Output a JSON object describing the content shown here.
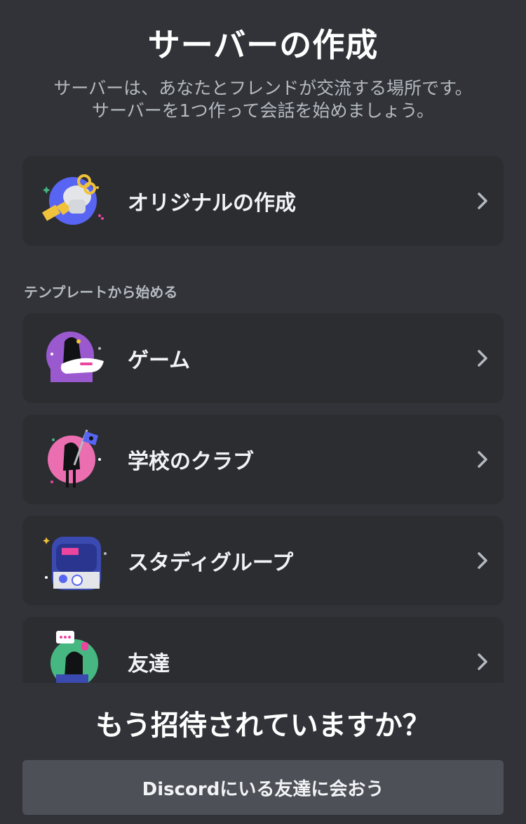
{
  "header": {
    "title": "サーバーの作成",
    "subtitle_line1": "サーバーは、あなたとフレンドが交流する場所です。",
    "subtitle_line2": "サーバーを1つ作って会話を始めましょう。"
  },
  "create_own": {
    "label": "オリジナルの作成",
    "icon": "chevron-right-icon"
  },
  "templates": {
    "section_label": "テンプレートから始める",
    "items": [
      {
        "label": "ゲーム",
        "icon": "game-illustration"
      },
      {
        "label": "学校のクラブ",
        "icon": "school-club-illustration"
      },
      {
        "label": "スタディグループ",
        "icon": "study-group-illustration"
      },
      {
        "label": "友達",
        "icon": "friends-illustration"
      }
    ]
  },
  "footer": {
    "title": "もう招待されていますか？",
    "button_label": "Discordにいる友達に会おう"
  },
  "colors": {
    "background": "#313338",
    "card": "#2b2d31",
    "button": "#4e5058",
    "text": "#f2f3f5",
    "muted": "#b5bac1"
  }
}
